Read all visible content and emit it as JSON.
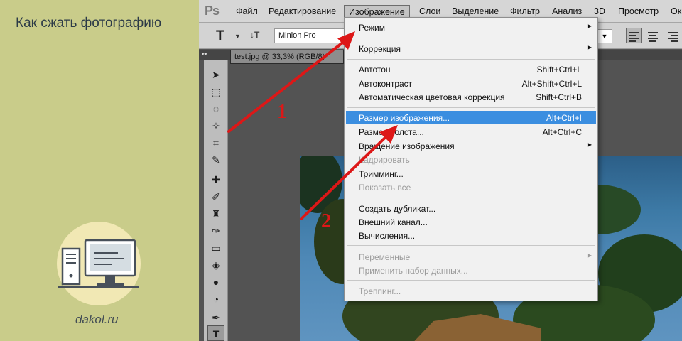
{
  "left_panel": {
    "title": "Как сжать фотографию",
    "brand": "dakol.ru"
  },
  "app": {
    "logo": "Ps",
    "menus": [
      "Файл",
      "Редактирование",
      "Изображение",
      "Слои",
      "Выделение",
      "Фильтр",
      "Анализ",
      "3D",
      "Просмотр",
      "Ок"
    ],
    "active_menu": "Изображение",
    "options_bar": {
      "tool_icon": "T",
      "orientation_icon": "↓T",
      "font_family_value": "Minion Pro"
    },
    "document_tab": "test.jpg @ 33,3% (RGB/8)",
    "tools": [
      "move-tool-icon",
      "marquee-tool-icon",
      "lasso-tool-icon",
      "magic-wand-icon",
      "crop-tool-icon",
      "eyedropper-icon",
      "healing-brush-icon",
      "brush-tool-icon",
      "clone-stamp-icon",
      "history-brush-icon",
      "eraser-icon",
      "paint-bucket-icon",
      "blur-tool-icon",
      "dodge-tool-icon",
      "pen-tool-icon",
      "type-tool-icon"
    ]
  },
  "dropdown": {
    "items": [
      {
        "label": "Режим",
        "shortcut": "",
        "submenu": true,
        "disabled": false
      },
      {
        "label": "Коррекция",
        "shortcut": "",
        "submenu": true,
        "disabled": false
      },
      {
        "label": "Автотон",
        "shortcut": "Shift+Ctrl+L",
        "submenu": false,
        "disabled": false
      },
      {
        "label": "Автоконтраст",
        "shortcut": "Alt+Shift+Ctrl+L",
        "submenu": false,
        "disabled": false
      },
      {
        "label": "Автоматическая цветовая коррекция",
        "shortcut": "Shift+Ctrl+B",
        "submenu": false,
        "disabled": false
      },
      {
        "label": "Размер изображения...",
        "shortcut": "Alt+Ctrl+I",
        "submenu": false,
        "disabled": false,
        "highlighted": true
      },
      {
        "label": "Размер холста...",
        "shortcut": "Alt+Ctrl+C",
        "submenu": false,
        "disabled": false
      },
      {
        "label": "Вращение изображения",
        "shortcut": "",
        "submenu": true,
        "disabled": false
      },
      {
        "label": "Кадрировать",
        "shortcut": "",
        "submenu": false,
        "disabled": true
      },
      {
        "label": "Тримминг...",
        "shortcut": "",
        "submenu": false,
        "disabled": false
      },
      {
        "label": "Показать все",
        "shortcut": "",
        "submenu": false,
        "disabled": true
      },
      {
        "label": "Создать дубликат...",
        "shortcut": "",
        "submenu": false,
        "disabled": false
      },
      {
        "label": "Внешний канал...",
        "shortcut": "",
        "submenu": false,
        "disabled": false
      },
      {
        "label": "Вычисления...",
        "shortcut": "",
        "submenu": false,
        "disabled": false
      },
      {
        "label": "Переменные",
        "shortcut": "",
        "submenu": true,
        "disabled": true
      },
      {
        "label": "Применить набор данных...",
        "shortcut": "",
        "submenu": false,
        "disabled": true
      },
      {
        "label": "Треппинг...",
        "shortcut": "",
        "submenu": false,
        "disabled": true
      }
    ]
  },
  "annotations": {
    "step1": "1",
    "step2": "2",
    "arrow_color": "#dd1717"
  },
  "colors": {
    "highlight": "#3b8ee0",
    "left_bg": "#c9cc8a"
  }
}
